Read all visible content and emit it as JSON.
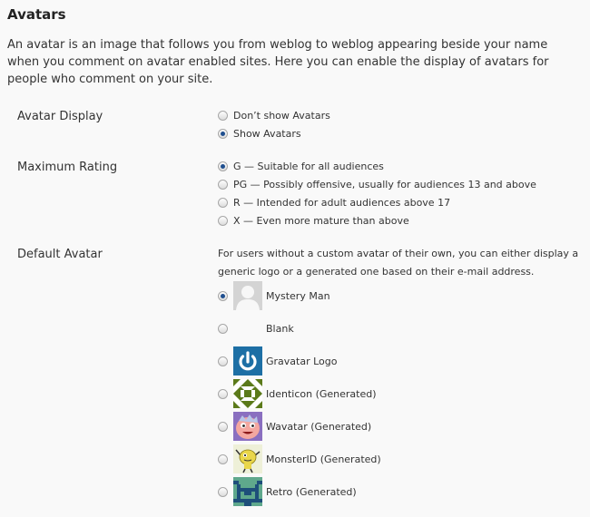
{
  "section_title": "Avatars",
  "intro": "An avatar is an image that follows you from weblog to weblog appearing beside your name when you comment on avatar enabled sites. Here you can enable the display of avatars for people who comment on your site.",
  "avatar_display": {
    "label": "Avatar Display",
    "options": [
      {
        "label": "Don’t show Avatars",
        "checked": false
      },
      {
        "label": "Show Avatars",
        "checked": true
      }
    ]
  },
  "maximum_rating": {
    "label": "Maximum Rating",
    "options": [
      {
        "label": "G — Suitable for all audiences",
        "checked": true
      },
      {
        "label": "PG — Possibly offensive, usually for audiences 13 and above",
        "checked": false
      },
      {
        "label": "R — Intended for adult audiences above 17",
        "checked": false
      },
      {
        "label": "X — Even more mature than above",
        "checked": false
      }
    ]
  },
  "default_avatar": {
    "label": "Default Avatar",
    "description": "For users without a custom avatar of their own, you can either display a generic logo or a generated one based on their e-mail address.",
    "options": [
      {
        "label": "Mystery Man",
        "checked": true,
        "icon": "mystery-man-icon"
      },
      {
        "label": "Blank",
        "checked": false,
        "icon": "blank-icon"
      },
      {
        "label": "Gravatar Logo",
        "checked": false,
        "icon": "gravatar-logo-icon"
      },
      {
        "label": "Identicon (Generated)",
        "checked": false,
        "icon": "identicon-icon"
      },
      {
        "label": "Wavatar (Generated)",
        "checked": false,
        "icon": "wavatar-icon"
      },
      {
        "label": "MonsterID (Generated)",
        "checked": false,
        "icon": "monsterid-icon"
      },
      {
        "label": "Retro (Generated)",
        "checked": false,
        "icon": "retro-icon"
      }
    ]
  }
}
